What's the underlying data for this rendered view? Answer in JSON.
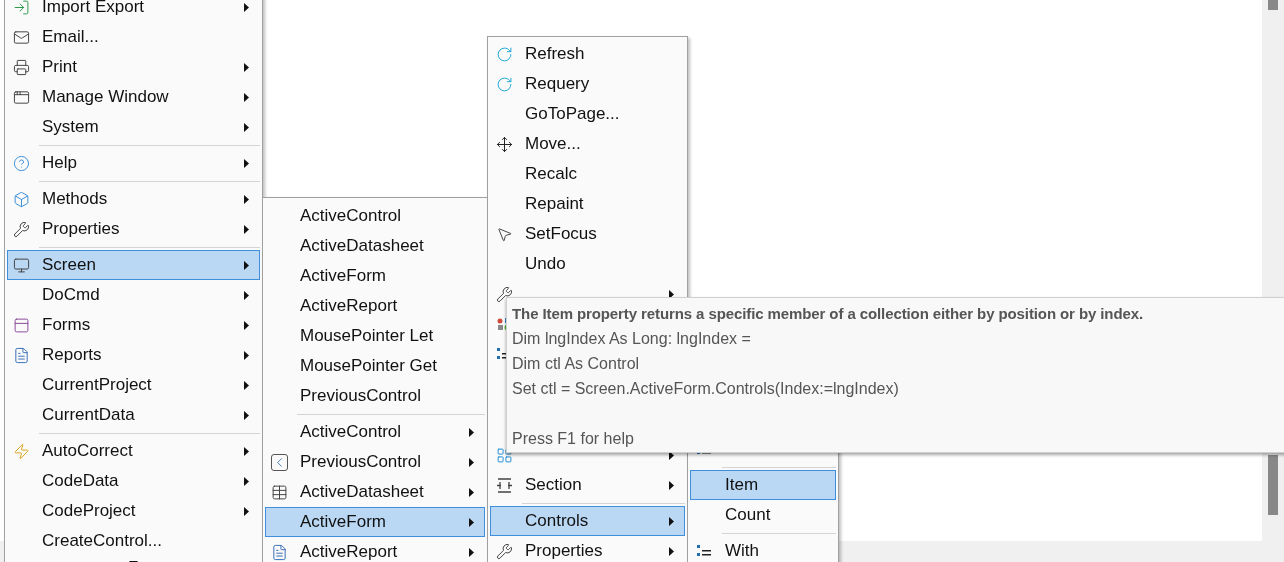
{
  "menus": [
    {
      "items": [
        {
          "label": "Import Export",
          "submenu": true,
          "selected": false
        },
        {
          "label": "Email...",
          "submenu": false,
          "selected": false
        },
        {
          "label": "Print",
          "submenu": true,
          "selected": false
        },
        {
          "label": "Manage Window",
          "submenu": true,
          "selected": false
        },
        {
          "label": "System",
          "submenu": true,
          "selected": false
        },
        {
          "kind": "separator"
        },
        {
          "label": "Help",
          "submenu": true,
          "selected": false
        },
        {
          "kind": "separator"
        },
        {
          "label": "Methods",
          "submenu": true,
          "selected": false
        },
        {
          "label": "Properties",
          "submenu": true,
          "selected": false
        },
        {
          "kind": "separator"
        },
        {
          "label": "Screen",
          "submenu": true,
          "selected": true
        },
        {
          "label": "DoCmd",
          "submenu": true,
          "selected": false
        },
        {
          "label": "Forms",
          "submenu": true,
          "selected": false
        },
        {
          "label": "Reports",
          "submenu": true,
          "selected": false
        },
        {
          "label": "CurrentProject",
          "submenu": true,
          "selected": false
        },
        {
          "label": "CurrentData",
          "submenu": true,
          "selected": false
        },
        {
          "kind": "separator"
        },
        {
          "label": "AutoCorrect",
          "submenu": true,
          "selected": false
        },
        {
          "label": "CodeData",
          "submenu": true,
          "selected": false
        },
        {
          "label": "CodeProject",
          "submenu": true,
          "selected": false
        },
        {
          "label": "CreateControl...",
          "submenu": false,
          "selected": false
        }
      ]
    },
    {
      "items": [
        {
          "label": "ActiveControl",
          "submenu": false,
          "selected": false
        },
        {
          "label": "ActiveDatasheet",
          "submenu": false,
          "selected": false
        },
        {
          "label": "ActiveForm",
          "submenu": false,
          "selected": false
        },
        {
          "label": "ActiveReport",
          "submenu": false,
          "selected": false
        },
        {
          "label": "MousePointer Let",
          "submenu": false,
          "selected": false
        },
        {
          "label": "MousePointer Get",
          "submenu": false,
          "selected": false
        },
        {
          "label": "PreviousControl",
          "submenu": false,
          "selected": false
        },
        {
          "kind": "separator"
        },
        {
          "label": "ActiveControl",
          "submenu": true,
          "selected": false
        },
        {
          "label": "PreviousControl",
          "submenu": true,
          "selected": false
        },
        {
          "label": "ActiveDatasheet",
          "submenu": true,
          "selected": false
        },
        {
          "label": "ActiveForm",
          "submenu": true,
          "selected": true
        },
        {
          "label": "ActiveReport",
          "submenu": true,
          "selected": false
        }
      ]
    },
    {
      "items": [
        {
          "label": "Refresh",
          "submenu": false,
          "selected": false
        },
        {
          "label": "Requery",
          "submenu": false,
          "selected": false
        },
        {
          "label": "GoToPage...",
          "submenu": false,
          "selected": false
        },
        {
          "label": "Move...",
          "submenu": false,
          "selected": false
        },
        {
          "label": "Recalc",
          "submenu": false,
          "selected": false
        },
        {
          "label": "Repaint",
          "submenu": false,
          "selected": false
        },
        {
          "label": "SetFocus",
          "submenu": false,
          "selected": false
        },
        {
          "label": "Undo",
          "submenu": false,
          "selected": false
        },
        {
          "kind": "covered",
          "submenu": true
        },
        {
          "kind": "covered"
        },
        {
          "kind": "covered"
        }
      ],
      "items_bottom": [
        {
          "kind": "covered",
          "submenu": true
        },
        {
          "label": "Section",
          "submenu": true,
          "selected": false
        },
        {
          "kind": "separator"
        },
        {
          "label": "Controls",
          "submenu": true,
          "selected": true
        },
        {
          "label": "Properties",
          "submenu": true,
          "selected": false
        }
      ]
    },
    {
      "items_bottom": [
        {
          "kind": "covered"
        },
        {
          "kind": "separator"
        },
        {
          "label": "Item",
          "submenu": false,
          "selected": true
        },
        {
          "label": "Count",
          "submenu": false,
          "selected": false
        },
        {
          "kind": "separator"
        },
        {
          "label": "With",
          "submenu": false,
          "selected": false
        }
      ]
    }
  ],
  "tooltip": {
    "title": "The Item property returns a specific member of a collection either by position or by index.",
    "lines": [
      "Dim lngIndex As Long: lngIndex =",
      "Dim ctl As Control",
      "Set ctl = Screen.ActiveForm.Controls(Index:=lngIndex)"
    ],
    "hint": "Press F1 for help"
  }
}
